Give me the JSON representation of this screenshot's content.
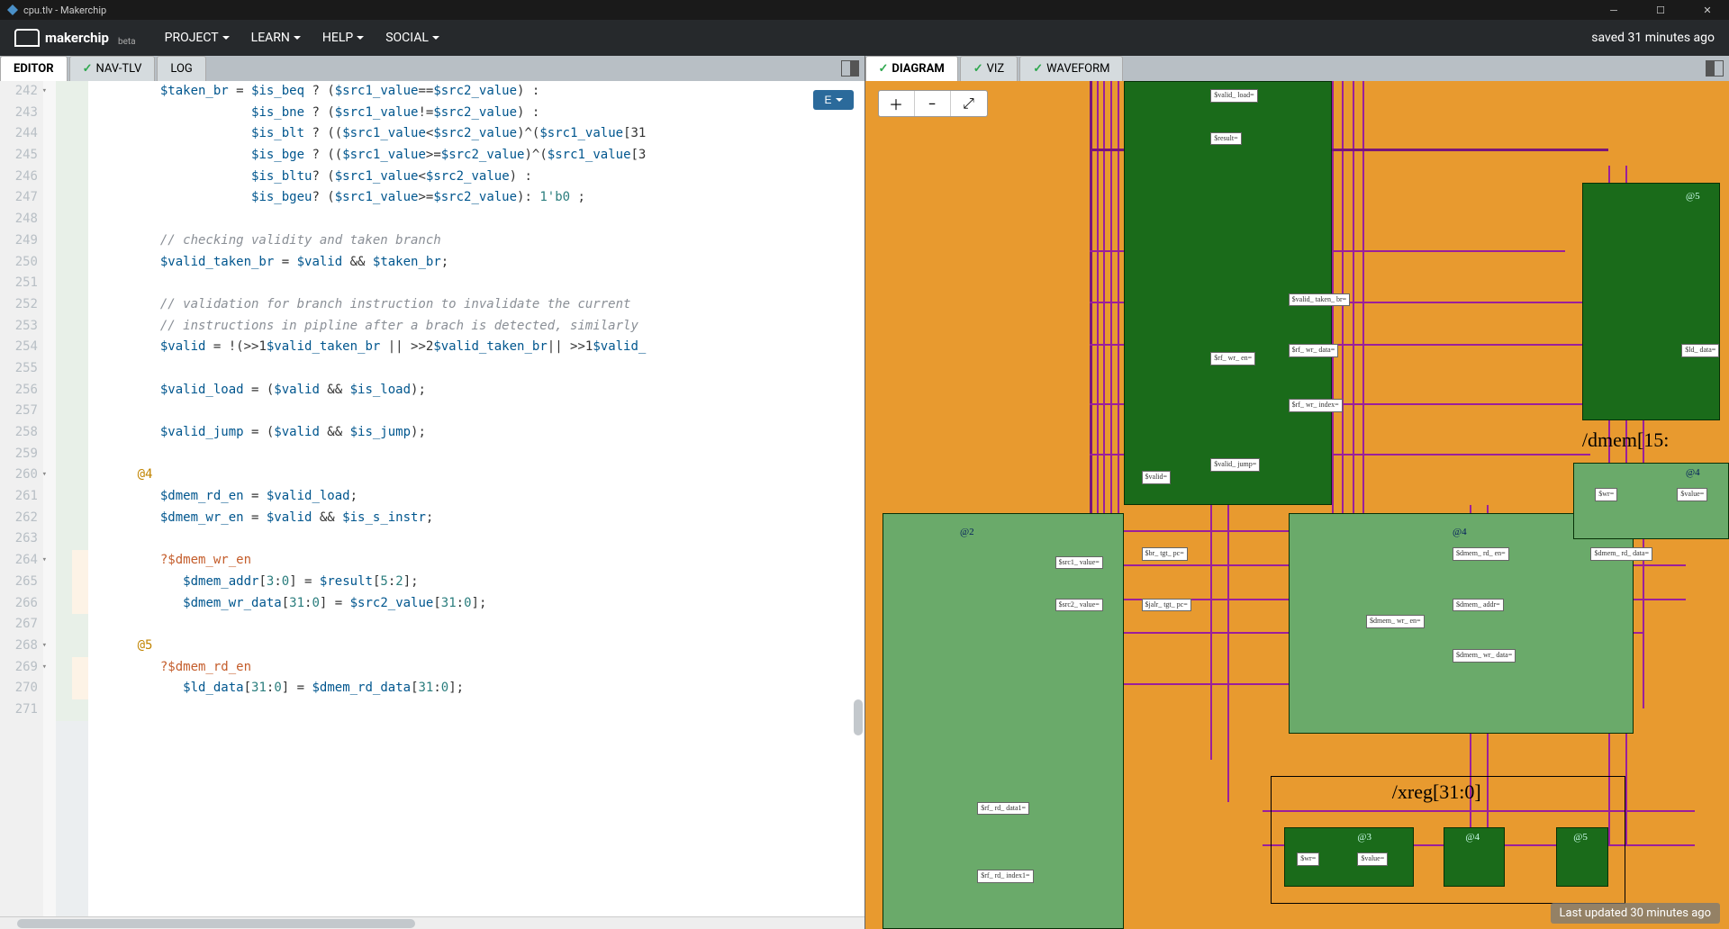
{
  "window": {
    "title": "cpu.tlv - Makerchip"
  },
  "brand": {
    "name": "makerchip",
    "beta": "beta"
  },
  "menu": {
    "project": "PROJECT",
    "learn": "LEARN",
    "help": "HELP",
    "social": "SOCIAL"
  },
  "status": {
    "saved": "saved 31 minutes ago",
    "updated": "Last updated 30 minutes ago"
  },
  "tabs_left": {
    "editor": "EDITOR",
    "navtlv": "NAV-TLV",
    "log": "LOG"
  },
  "tabs_right": {
    "diagram": "DIAGRAM",
    "viz": "VIZ",
    "waveform": "WAVEFORM"
  },
  "e_button": "E",
  "code": {
    "lines": [
      {
        "n": 242,
        "fold": true,
        "cls": "",
        "html": "         <span class='tok-var'>$taken_br</span> = <span class='tok-var'>$is_beq</span> ? (<span class='tok-var'>$src1_value</span>==<span class='tok-var'>$src2_value</span>) :"
      },
      {
        "n": 243,
        "html": "                     <span class='tok-var'>$is_bne</span> ? (<span class='tok-var'>$src1_value</span>!=<span class='tok-var'>$src2_value</span>) :"
      },
      {
        "n": 244,
        "html": "                     <span class='tok-var'>$is_blt</span> ? ((<span class='tok-var'>$src1_value</span>&lt;<span class='tok-var'>$src2_value</span>)^(<span class='tok-var'>$src1_value</span>[31"
      },
      {
        "n": 245,
        "html": "                     <span class='tok-var'>$is_bge</span> ? ((<span class='tok-var'>$src1_value</span>&gt;=<span class='tok-var'>$src2_value</span>)^(<span class='tok-var'>$src1_value</span>[3"
      },
      {
        "n": 246,
        "html": "                     <span class='tok-var'>$is_bltu</span>? (<span class='tok-var'>$src1_value</span>&lt;<span class='tok-var'>$src2_value</span>) :"
      },
      {
        "n": 247,
        "html": "                     <span class='tok-var'>$is_bgeu</span>? (<span class='tok-var'>$src1_value</span>&gt;=<span class='tok-var'>$src2_value</span>): <span class='tok-num'>1'b0</span> ;"
      },
      {
        "n": 248,
        "html": ""
      },
      {
        "n": 249,
        "html": "         <span class='tok-com'>// checking validity and taken branch</span>"
      },
      {
        "n": 250,
        "html": "         <span class='tok-var'>$valid_taken_br</span> = <span class='tok-var'>$valid</span> &amp;&amp; <span class='tok-var'>$taken_br</span>;"
      },
      {
        "n": 251,
        "html": ""
      },
      {
        "n": 252,
        "html": "         <span class='tok-com'>// validation for branch instruction to invalidate the current</span>"
      },
      {
        "n": 253,
        "html": "         <span class='tok-com'>// instructions in pipline after a brach is detected, similarly</span>"
      },
      {
        "n": 254,
        "html": "         <span class='tok-var'>$valid</span> = !(&gt;&gt;1<span class='tok-var'>$valid_taken_br</span> || &gt;&gt;2<span class='tok-var'>$valid_taken_br</span>|| &gt;&gt;1<span class='tok-var'>$valid_</span>"
      },
      {
        "n": 255,
        "html": ""
      },
      {
        "n": 256,
        "html": "         <span class='tok-var'>$valid_load</span> = (<span class='tok-var'>$valid</span> &amp;&amp; <span class='tok-var'>$is_load</span>);"
      },
      {
        "n": 257,
        "html": ""
      },
      {
        "n": 258,
        "html": "         <span class='tok-var'>$valid_jump</span> = (<span class='tok-var'>$valid</span> &amp;&amp; <span class='tok-var'>$is_jump</span>);"
      },
      {
        "n": 259,
        "html": ""
      },
      {
        "n": 260,
        "fold": true,
        "stage": "4",
        "html": "      <span class='tok-stage'>@4</span>"
      },
      {
        "n": 261,
        "html": "         <span class='tok-var'>$dmem_rd_en</span> = <span class='tok-var'>$valid_load</span>;"
      },
      {
        "n": 262,
        "html": "         <span class='tok-var'>$dmem_wr_en</span> = <span class='tok-var'>$valid</span> &amp;&amp; <span class='tok-var'>$is_s_instr</span>;"
      },
      {
        "n": 263,
        "html": ""
      },
      {
        "n": 264,
        "fold": true,
        "cond": true,
        "html": "         <span class='tok-cond'>?$dmem_wr_en</span>"
      },
      {
        "n": 265,
        "cond": true,
        "html": "            <span class='tok-var'>$dmem_addr</span>[<span class='tok-num'>3</span>:<span class='tok-num'>0</span>] = <span class='tok-var'>$result</span>[<span class='tok-num'>5</span>:<span class='tok-num'>2</span>];"
      },
      {
        "n": 266,
        "cond": true,
        "html": "            <span class='tok-var'>$dmem_wr_data</span>[<span class='tok-num'>31</span>:<span class='tok-num'>0</span>] = <span class='tok-var'>$src2_value</span>[<span class='tok-num'>31</span>:<span class='tok-num'>0</span>];"
      },
      {
        "n": 267,
        "html": ""
      },
      {
        "n": 268,
        "fold": true,
        "stage": "5",
        "html": "      <span class='tok-stage'>@5</span>"
      },
      {
        "n": 269,
        "fold": true,
        "cond": true,
        "html": "         <span class='tok-cond'>?$dmem_rd_en</span>"
      },
      {
        "n": 270,
        "cond": true,
        "html": "            <span class='tok-var'>$ld_data</span>[<span class='tok-num'>31</span>:<span class='tok-num'>0</span>] = <span class='tok-var'>$dmem_rd_data</span>[<span class='tok-num'>31</span>:<span class='tok-num'>0</span>];"
      },
      {
        "n": 271,
        "html": ""
      }
    ]
  },
  "diagram": {
    "hier_dmem": "/dmem[15:",
    "hier_xreg": "/xreg[31:0]",
    "stage2": "@2",
    "stage3": "@3",
    "stage4": "@4",
    "stage4b": "@4",
    "stage5": "@5",
    "stage5b": "@5",
    "sig": {
      "valid_load": "$valid_\nload=",
      "result": "$result=",
      "valid_taken_br": "$valid_\ntaken_\nbr=",
      "rf_wr_data": "$rf_\nwr_\ndata=",
      "rf_wr_en": "$rf_\nwr_\nen=",
      "rf_wr_index": "$rf_\nwr_\nindex=",
      "valid_jump": "$valid_\njump=",
      "valid": "$valid=",
      "ld_data": "$ld_\ndata=",
      "src1_value": "$src1_\nvalue=",
      "src2_value": "$src2_\nvalue=",
      "br_tgt_pc": "$br_\ntgt_\npc=",
      "jalr_tgt_pc": "$jalr_\ntgt_\npc=",
      "dmem_rd_en": "$dmem_\nrd_\nen=",
      "dmem_rd_data": "$dmem_\nrd_\ndata=",
      "dmem_addr": "$dmem_\naddr=",
      "dmem_wr_en": "$dmem_\nwr_\nen=",
      "dmem_wr_data": "$dmem_\nwr_\ndata=",
      "wr": "$wr=",
      "value": "$value=",
      "rf_rd_data1": "$rf_\nrd_\ndata1=",
      "rf_rd_index1": "$rf_\nrd_\nindex1="
    }
  }
}
